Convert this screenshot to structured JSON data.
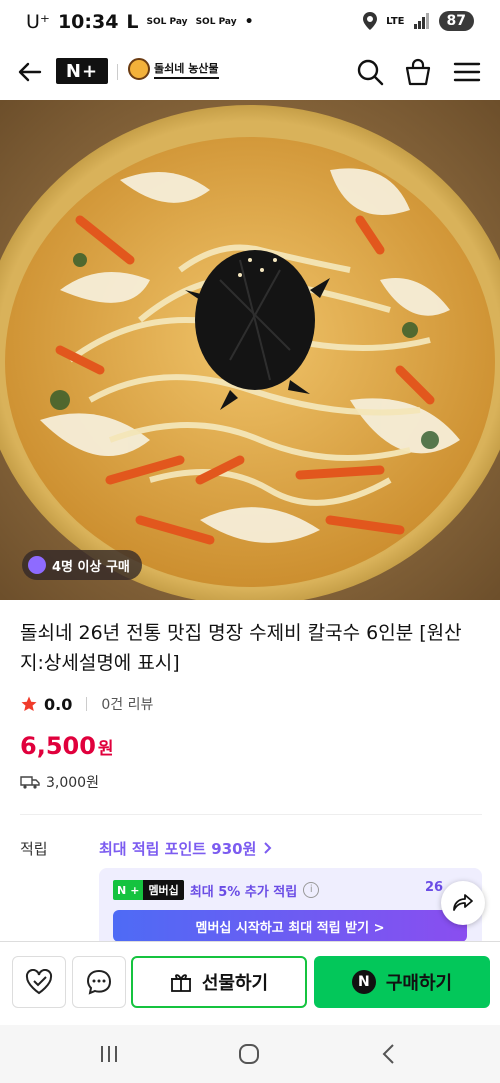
{
  "status_bar": {
    "carrier": "U⁺",
    "time": "10:34",
    "l_icon": "L",
    "pay1": "SOL Pay",
    "pay2": "SOL Pay",
    "dot": "•",
    "network": "LTE",
    "battery": "87",
    "icons": [
      "location-icon",
      "signal-icon"
    ]
  },
  "nav": {
    "back_icon": "arrow-left-icon",
    "nplus_logo": "N+",
    "store_name": "돌쇠네 농산물",
    "icons": [
      "search-icon",
      "bag-icon",
      "menu-icon"
    ]
  },
  "product": {
    "purchase_chip": "4명 이상 구매",
    "title": "돌쇠네 26년 전통 맛집 명장 수제비 칼국수 6인분 [원산지:상세설명에 표시]",
    "rating": "0.0",
    "reviews": "0건 리뷰",
    "price": "6,500",
    "price_unit": "원",
    "shipping": "3,000원"
  },
  "points": {
    "label": "적립",
    "max_link": "최대 적립 포인트 930원",
    "membership_badge_n": "N",
    "membership_badge_plus": "+",
    "membership_badge_text": "멤버십",
    "extra_text": "최대 5% 추가 적립",
    "info_icon": "ⓘ",
    "extra_amount": "26",
    "cta": "멤버십 시작하고 최대 적립 받기 >"
  },
  "bottom_bar": {
    "gift": "선물하기",
    "buy": "구매하기",
    "buy_logo": "N"
  },
  "colors": {
    "accent_green": "#03c75a",
    "price_red": "#e0003c",
    "points_purple": "#7c5cf0"
  }
}
